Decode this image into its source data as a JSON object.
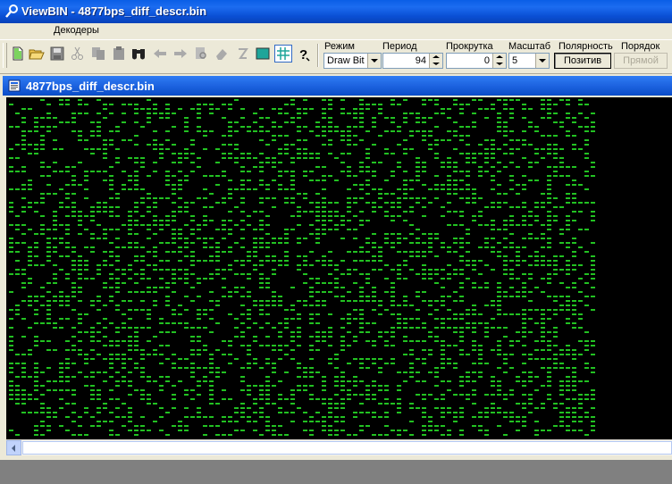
{
  "app": {
    "title": "ViewBIN - 4877bps_diff_descr.bin"
  },
  "menu": {
    "items": [
      "Декодеры"
    ]
  },
  "toolbar": {
    "buttons": [
      "new-file-icon",
      "open-folder-icon",
      "save-icon",
      "cut-icon",
      "copy-icon",
      "paste-icon",
      "find-binoculars-icon",
      "back-arrow-icon",
      "forward-arrow-icon",
      "page-find-icon",
      "eraser-icon",
      "italic-z-icon",
      "square-icon",
      "grid-icon",
      "help-icon"
    ],
    "mode": {
      "label": "Режим",
      "value": "Draw Bit"
    },
    "period": {
      "label": "Период",
      "value": "94"
    },
    "scroll": {
      "label": "Прокрутка",
      "value": "0"
    },
    "scale": {
      "label": "Масштаб",
      "value": "5"
    },
    "polarity": {
      "label": "Полярность",
      "value": "Позитив"
    },
    "order": {
      "label": "Порядок",
      "value": "Прямой"
    }
  },
  "document": {
    "title": "4877bps_diff_descr.bin",
    "bit_color": "#22c122",
    "background_color": "#000000"
  }
}
